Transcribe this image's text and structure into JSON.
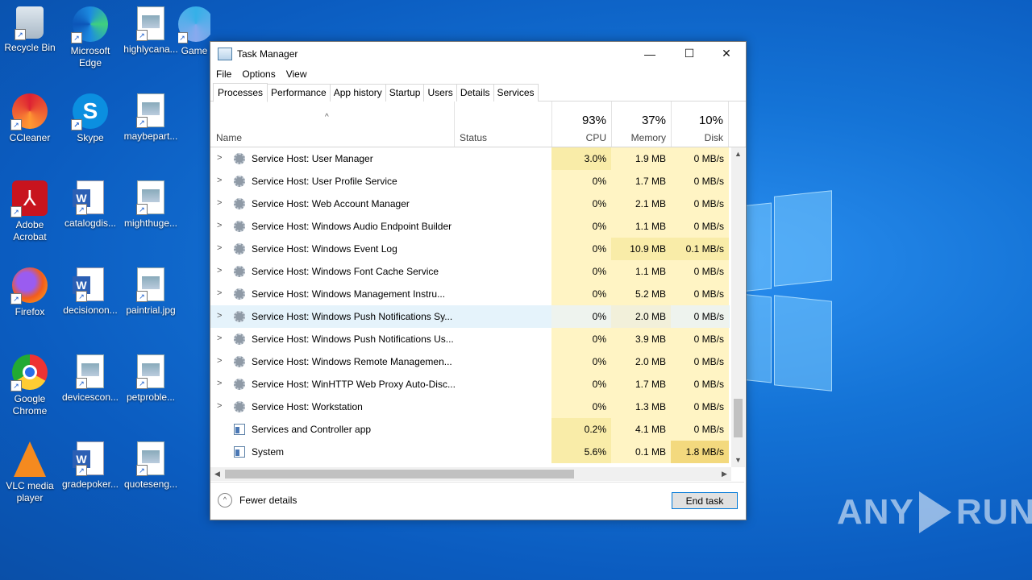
{
  "desktop": {
    "icons": [
      {
        "label": "Recycle Bin",
        "icon": "recycle-bin-icon"
      },
      {
        "label": "Microsoft Edge",
        "icon": "edge-icon"
      },
      {
        "label": "highlycana...",
        "icon": "image-file-icon"
      },
      {
        "label": "Game",
        "icon": "game-icon"
      },
      {
        "label": "CCleaner",
        "icon": "ccleaner-icon"
      },
      {
        "label": "Skype",
        "icon": "skype-icon"
      },
      {
        "label": "maybepart...",
        "icon": "image-file-icon"
      },
      {
        "label": "Adobe Acrobat",
        "icon": "acrobat-icon"
      },
      {
        "label": "catalogdis...",
        "icon": "word-doc-icon"
      },
      {
        "label": "mighthuge...",
        "icon": "image-file-icon"
      },
      {
        "label": "Firefox",
        "icon": "firefox-icon"
      },
      {
        "label": "decisionon...",
        "icon": "word-doc-icon"
      },
      {
        "label": "paintrial.jpg",
        "icon": "image-file-icon"
      },
      {
        "label": "Google Chrome",
        "icon": "chrome-icon"
      },
      {
        "label": "devicescon...",
        "icon": "image-file-icon"
      },
      {
        "label": "petproble...",
        "icon": "image-file-icon"
      },
      {
        "label": "VLC media player",
        "icon": "vlc-icon"
      },
      {
        "label": "gradepoker...",
        "icon": "word-doc-icon"
      },
      {
        "label": "quoteseng...",
        "icon": "image-file-icon"
      }
    ],
    "watermark": "ANY RUN"
  },
  "window": {
    "title": "Task Manager",
    "controls": {
      "minimize": "—",
      "maximize": "☐",
      "close": "✕"
    }
  },
  "menu": [
    "File",
    "Options",
    "View"
  ],
  "tabs": [
    "Processes",
    "Performance",
    "App history",
    "Startup",
    "Users",
    "Details",
    "Services"
  ],
  "active_tab": "Processes",
  "columns": {
    "name": "Name",
    "status": "Status",
    "cpu": {
      "percent": "93%",
      "label": "CPU"
    },
    "memory": {
      "percent": "37%",
      "label": "Memory"
    },
    "disk": {
      "percent": "10%",
      "label": "Disk"
    }
  },
  "processes": [
    {
      "name": "Service Host: User Manager",
      "cpu": "3.0%",
      "mem": "1.9 MB",
      "disk": "0 MB/s",
      "expandable": true,
      "icon": "gear"
    },
    {
      "name": "Service Host: User Profile Service",
      "cpu": "0%",
      "mem": "1.7 MB",
      "disk": "0 MB/s",
      "expandable": true,
      "icon": "gear"
    },
    {
      "name": "Service Host: Web Account Manager",
      "cpu": "0%",
      "mem": "2.1 MB",
      "disk": "0 MB/s",
      "expandable": true,
      "icon": "gear"
    },
    {
      "name": "Service Host: Windows Audio Endpoint Builder",
      "cpu": "0%",
      "mem": "1.1 MB",
      "disk": "0 MB/s",
      "expandable": true,
      "icon": "gear"
    },
    {
      "name": "Service Host: Windows Event Log",
      "cpu": "0%",
      "mem": "10.9 MB",
      "disk": "0.1 MB/s",
      "expandable": true,
      "icon": "gear"
    },
    {
      "name": "Service Host: Windows Font Cache Service",
      "cpu": "0%",
      "mem": "1.1 MB",
      "disk": "0 MB/s",
      "expandable": true,
      "icon": "gear"
    },
    {
      "name": "Service Host: Windows Management Instru...",
      "cpu": "0%",
      "mem": "5.2 MB",
      "disk": "0 MB/s",
      "expandable": true,
      "icon": "gear"
    },
    {
      "name": "Service Host: Windows Push Notifications Sy...",
      "cpu": "0%",
      "mem": "2.0 MB",
      "disk": "0 MB/s",
      "expandable": true,
      "icon": "gear",
      "selected": true
    },
    {
      "name": "Service Host: Windows Push Notifications Us...",
      "cpu": "0%",
      "mem": "3.9 MB",
      "disk": "0 MB/s",
      "expandable": true,
      "icon": "gear"
    },
    {
      "name": "Service Host: Windows Remote Managemen...",
      "cpu": "0%",
      "mem": "2.0 MB",
      "disk": "0 MB/s",
      "expandable": true,
      "icon": "gear"
    },
    {
      "name": "Service Host: WinHTTP Web Proxy Auto-Disc...",
      "cpu": "0%",
      "mem": "1.7 MB",
      "disk": "0 MB/s",
      "expandable": true,
      "icon": "gear"
    },
    {
      "name": "Service Host: Workstation",
      "cpu": "0%",
      "mem": "1.3 MB",
      "disk": "0 MB/s",
      "expandable": true,
      "icon": "gear"
    },
    {
      "name": "Services and Controller app",
      "cpu": "0.2%",
      "mem": "4.1 MB",
      "disk": "0 MB/s",
      "expandable": false,
      "icon": "app"
    },
    {
      "name": "System",
      "cpu": "5.6%",
      "mem": "0.1 MB",
      "disk": "1.8 MB/s",
      "expandable": false,
      "icon": "app"
    }
  ],
  "footer": {
    "fewer_details": "Fewer details",
    "end_task": "End task"
  },
  "colors": {
    "heat_low": "#fff4c4",
    "heat_mid": "#f9eca8",
    "heat_high": "#f3d97e",
    "selected_row": "#e5f3fb",
    "accent": "#0078d7"
  }
}
